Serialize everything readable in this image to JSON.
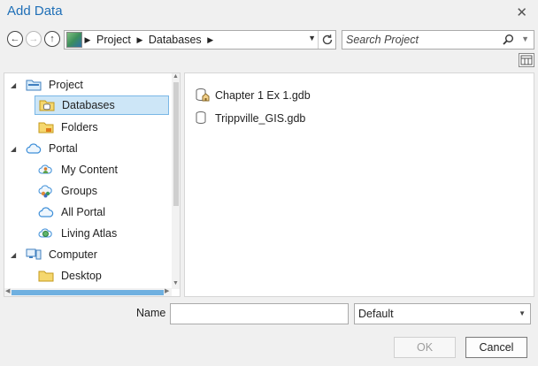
{
  "window": {
    "title": "Add Data",
    "close_glyph": "✕"
  },
  "navigation": {
    "back_glyph": "←",
    "forward_glyph": "→",
    "up_glyph": "↑",
    "breadcrumb": [
      "Project",
      "Databases"
    ],
    "search_placeholder": "Search Project"
  },
  "tree": {
    "items": [
      {
        "label": "Project",
        "icon": "project-folder-icon",
        "expanded": true
      },
      {
        "label": "Databases",
        "icon": "database-folder-icon",
        "selected": true
      },
      {
        "label": "Folders",
        "icon": "folder-icon"
      },
      {
        "label": "Portal",
        "icon": "cloud-icon",
        "expanded": true
      },
      {
        "label": "My Content",
        "icon": "my-content-icon"
      },
      {
        "label": "Groups",
        "icon": "groups-icon"
      },
      {
        "label": "All Portal",
        "icon": "cloud-icon"
      },
      {
        "label": "Living Atlas",
        "icon": "living-atlas-icon"
      },
      {
        "label": "Computer",
        "icon": "computer-icon",
        "expanded": true
      },
      {
        "label": "Desktop",
        "icon": "desktop-folder-icon"
      }
    ]
  },
  "content": {
    "items": [
      {
        "label": "Chapter 1 Ex 1.gdb",
        "icon": "geodatabase-home-icon"
      },
      {
        "label": "Trippville_GIS.gdb",
        "icon": "geodatabase-icon"
      }
    ]
  },
  "footer": {
    "name_label": "Name",
    "name_value": "",
    "filter_value": "Default",
    "ok_label": "OK",
    "cancel_label": "Cancel"
  },
  "colors": {
    "title": "#1f6fb7",
    "selection": "#cde6f7",
    "selection_border": "#7ab7e6",
    "scroll_thumb": "#6fb0e0"
  }
}
